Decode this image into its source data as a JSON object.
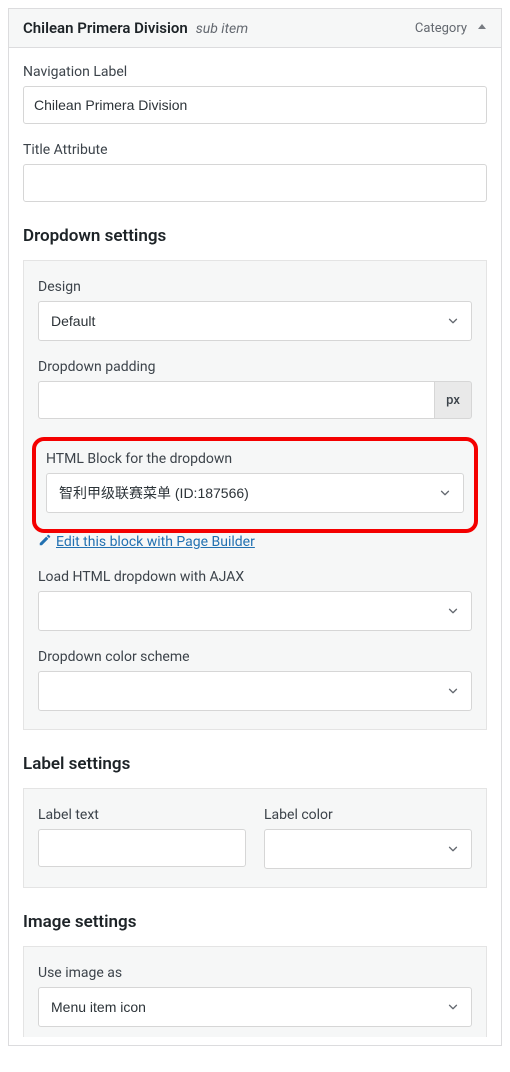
{
  "header": {
    "title": "Chilean Primera Division",
    "sub": "sub item",
    "type": "Category"
  },
  "nav_label": {
    "label": "Navigation Label",
    "value": "Chilean Primera Division"
  },
  "title_attr": {
    "label": "Title Attribute",
    "value": ""
  },
  "dropdown": {
    "heading": "Dropdown settings",
    "design": {
      "label": "Design",
      "value": "Default"
    },
    "padding": {
      "label": "Dropdown padding",
      "unit": "px",
      "value": ""
    },
    "html_block": {
      "label": "HTML Block for the dropdown",
      "value": "智利甲级联赛菜单 (ID:187566)"
    },
    "edit_link": "Edit this block with Page Builder",
    "ajax": {
      "label": "Load HTML dropdown with AJAX",
      "value": ""
    },
    "color_scheme": {
      "label": "Dropdown color scheme",
      "value": ""
    }
  },
  "label_section": {
    "heading": "Label settings",
    "text": {
      "label": "Label text",
      "value": ""
    },
    "color": {
      "label": "Label color",
      "value": ""
    }
  },
  "image_section": {
    "heading": "Image settings",
    "use_as": {
      "label": "Use image as",
      "value": "Menu item icon"
    }
  }
}
